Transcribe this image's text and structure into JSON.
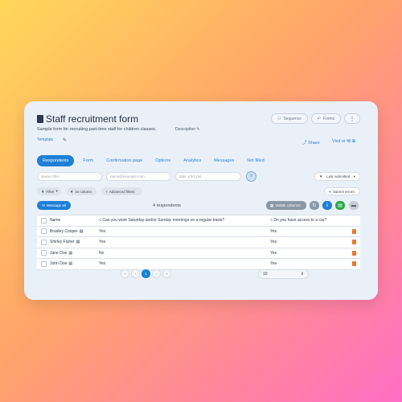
{
  "header": {
    "title": "Staff recruitment form",
    "subtitle": "Sample form for recruiting part-time staff for children classes.",
    "description_link": "Description",
    "template_label": "Template",
    "sequence_label": "Sequence",
    "forms_label": "Forms",
    "more_label": "⋮",
    "share_label": "Share",
    "visit_label": "Visit or fill"
  },
  "tabs": [
    {
      "label": "Respondents"
    },
    {
      "label": "Form"
    },
    {
      "label": "Confirmation page"
    },
    {
      "label": "Options"
    },
    {
      "label": "Analytics"
    },
    {
      "label": "Messages"
    },
    {
      "label": "Not filled"
    }
  ],
  "filters": {
    "name_placeholder": "Name Filter",
    "email_placeholder": "name@example.com",
    "date_placeholder": "date 1/2/1234",
    "sort_label": "Last submitted",
    "filter_label": "Filter",
    "column_label": "2x column",
    "advanced_label": "Advanced filters",
    "submit_errors_label": "Submit errors"
  },
  "toolbar": {
    "message_all_label": "Message all",
    "respondents_count": "4 respondents",
    "visible_columns_label": "Visible columns"
  },
  "table": {
    "headers": [
      "Name",
      "Can you work Saturday and/or Sunday mornings on a regular basis?",
      "Do you have access to a car?"
    ],
    "rows": [
      {
        "name": "Bradley Cooper",
        "q1": "Yes",
        "q2": "Yes"
      },
      {
        "name": "Shirley Fisher",
        "q1": "Yes",
        "q2": "Yes"
      },
      {
        "name": "Jane Doe",
        "q1": "No",
        "q2": "Yes"
      },
      {
        "name": "John Doe",
        "q1": "Yes",
        "q2": "Yes"
      }
    ]
  },
  "pagination": {
    "first": "«",
    "prev": "‹",
    "current": "1",
    "next": "›",
    "last": "»",
    "per_page": "10"
  },
  "colors": {
    "accent": "#1e7fd6",
    "delete": "#e8792b",
    "green": "#2aa84a"
  }
}
